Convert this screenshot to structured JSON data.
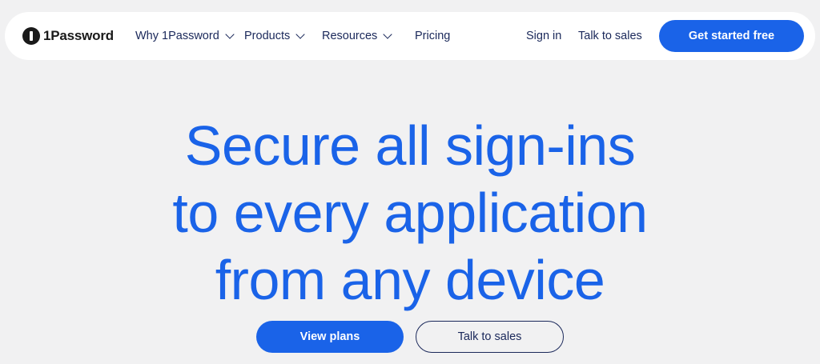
{
  "brand": {
    "name": "1Password",
    "logo_icon": "1password-keyhole-icon",
    "accent_color": "#1a63e8",
    "navy_color": "#1a285a"
  },
  "nav": {
    "items": [
      {
        "label": "Why 1Password",
        "has_dropdown": true
      },
      {
        "label": "Products",
        "has_dropdown": true
      },
      {
        "label": "Resources",
        "has_dropdown": true
      },
      {
        "label": "Pricing",
        "has_dropdown": false
      }
    ],
    "sign_in": "Sign in",
    "talk_to_sales": "Talk to sales",
    "cta": "Get started free"
  },
  "hero": {
    "headline_lines": [
      "Secure all sign-ins",
      "to every application",
      "from any device"
    ],
    "primary_button": "View plans",
    "secondary_button": "Talk to sales"
  }
}
